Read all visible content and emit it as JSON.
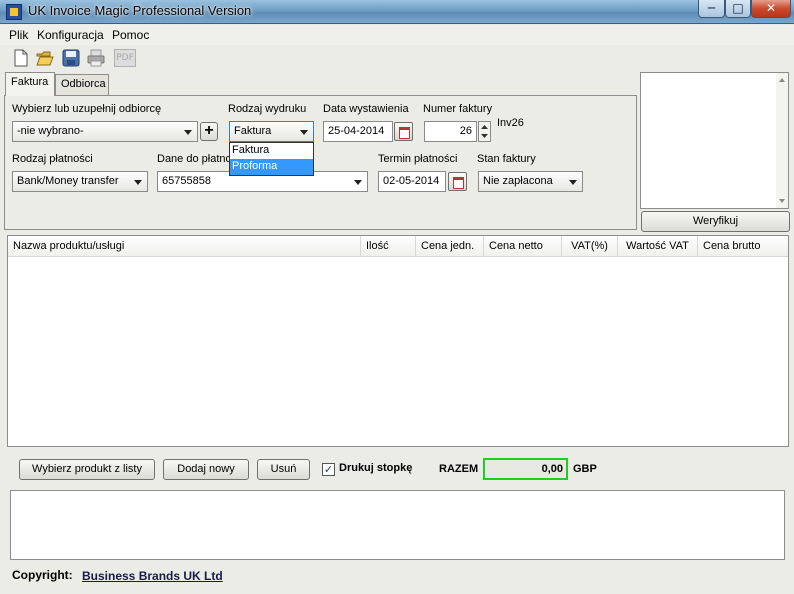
{
  "window": {
    "title": "UK Invoice Magic Professional Version",
    "icon": "app-icon",
    "min_label": "─",
    "max_label": "□",
    "close_label": "✕"
  },
  "menu": [
    "Plik",
    "Konfiguracja",
    "Pomoc"
  ],
  "toolbar": {
    "icons": [
      "new-document-icon",
      "open-folder-icon",
      "save-icon",
      "print-icon",
      "pdf-icon"
    ],
    "pdf_label": "PDF"
  },
  "tabs": [
    {
      "label": "Faktura",
      "active": true
    },
    {
      "label": "Odbiorca",
      "active": false
    }
  ],
  "form": {
    "recipient": {
      "label": "Wybierz lub uzupełnij odbiorcę",
      "value": "-nie wybrano-",
      "add_label": "+"
    },
    "print_type": {
      "label": "Rodzaj wydruku",
      "value": "Faktura",
      "options": [
        "Faktura",
        "Proforma"
      ],
      "highlighted": "Proforma"
    },
    "issue_date": {
      "label": "Data wystawienia",
      "value": "25-04-2014"
    },
    "invoice_number": {
      "label": "Numer faktury",
      "value": "26",
      "suffix": "Inv26"
    },
    "payment_type": {
      "label": "Rodzaj płatności",
      "value": "Bank/Money transfer"
    },
    "payment_data": {
      "label": "Dane do płatno",
      "value": "65755858"
    },
    "payment_due": {
      "label": "Termin płatności",
      "value": "02-05-2014"
    },
    "invoice_status": {
      "label": "Stan faktury",
      "value": "Nie zapłacona"
    }
  },
  "side_panel": {
    "verify_label": "Weryfikuj"
  },
  "table": {
    "columns": [
      "Nazwa produktu/usługi",
      "Ilość",
      "Cena jedn.",
      "Cena netto",
      "VAT(%)",
      "Wartość VAT",
      "Cena brutto"
    ],
    "rows": []
  },
  "bottom": {
    "choose_product_label": "Wybierz produkt z listy",
    "add_new_label": "Dodaj nowy",
    "delete_label": "Usuń",
    "print_footer_label": "Drukuj stopkę",
    "print_footer_checked": true,
    "total_label": "RAZEM",
    "total_value": "0,00",
    "currency": "GBP"
  },
  "footer": {
    "copyright_label": "Copyright:",
    "company": "Business Brands UK Ltd"
  },
  "colors": {
    "total_border": "#22cc22",
    "highlight": "#3399ff"
  }
}
